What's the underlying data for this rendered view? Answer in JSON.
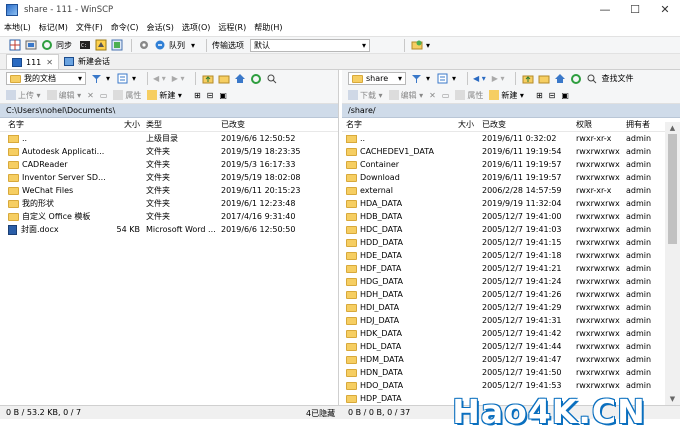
{
  "window": {
    "title": "share - 111 - WinSCP",
    "buttons": [
      "—",
      "☐",
      "✕"
    ]
  },
  "menu": [
    "本地(L)",
    "标记(M)",
    "文件(F)",
    "命令(C)",
    "会话(S)",
    "选项(O)",
    "远程(R)",
    "帮助(H)"
  ],
  "toolbar": {
    "sync_label": "同步",
    "queue_label": "队列",
    "transfer_label": "传输选项",
    "transfer_value": "默认"
  },
  "tabs": [
    {
      "label": "111"
    },
    {
      "label": "新建会话"
    }
  ],
  "left": {
    "location": "我的文档",
    "actions": {
      "upload": "上传",
      "edit": "编辑",
      "properties": "属性",
      "new": "新建"
    },
    "path": "C:\\Users\\nohel\\Documents\\",
    "headers": {
      "name": "名字",
      "size": "大小",
      "type": "类型",
      "changed": "已改变"
    },
    "rows": [
      {
        "name": "..",
        "size": "",
        "type": "上级目录",
        "changed": "2019/6/6  12:50:52",
        "kind": "up"
      },
      {
        "name": "Autodesk Applicati...",
        "size": "",
        "type": "文件夹",
        "changed": "2019/5/19  18:23:35",
        "kind": "folder"
      },
      {
        "name": "CADReader",
        "size": "",
        "type": "文件夹",
        "changed": "2019/5/3  16:17:33",
        "kind": "folder"
      },
      {
        "name": "Inventor Server SD...",
        "size": "",
        "type": "文件夹",
        "changed": "2019/5/19  18:02:08",
        "kind": "folder"
      },
      {
        "name": "WeChat Files",
        "size": "",
        "type": "文件夹",
        "changed": "2019/6/11  20:15:23",
        "kind": "folder"
      },
      {
        "name": "我的形状",
        "size": "",
        "type": "文件夹",
        "changed": "2019/6/1  12:23:48",
        "kind": "folder"
      },
      {
        "name": "自定义 Office 模板",
        "size": "",
        "type": "文件夹",
        "changed": "2017/4/16  9:31:40",
        "kind": "folder"
      },
      {
        "name": "封面.docx",
        "size": "54 KB",
        "type": "Microsoft Word ...",
        "changed": "2019/6/6  12:50:50",
        "kind": "doc"
      }
    ],
    "status_left": "0 B / 53.2 KB,  0 / 7",
    "status_right": "4已隐藏"
  },
  "right": {
    "location": "share",
    "find_label": "查找文件",
    "actions": {
      "download": "下载",
      "edit": "编辑",
      "properties": "属性",
      "new": "新建"
    },
    "path": "/share/",
    "headers": {
      "name": "名字",
      "size": "大小",
      "changed": "已改变",
      "rights": "权限",
      "owner": "拥有者"
    },
    "rows": [
      {
        "name": "..",
        "changed": "2019/6/11  0:32:02",
        "rights": "rwxr-xr-x",
        "owner": "admin",
        "kind": "up"
      },
      {
        "name": "CACHEDEV1_DATA",
        "changed": "2019/6/11  19:19:54",
        "rights": "rwxrwxrwx",
        "owner": "admin",
        "kind": "folder"
      },
      {
        "name": "Container",
        "changed": "2019/6/11  19:19:57",
        "rights": "rwxrwxrwx",
        "owner": "admin",
        "kind": "folder"
      },
      {
        "name": "Download",
        "changed": "2019/6/11  19:19:57",
        "rights": "rwxrwxrwx",
        "owner": "admin",
        "kind": "folder"
      },
      {
        "name": "external",
        "changed": "2006/2/28  14:57:59",
        "rights": "rwxr-xr-x",
        "owner": "admin",
        "kind": "folder"
      },
      {
        "name": "HDA_DATA",
        "changed": "2019/9/19  11:32:04",
        "rights": "rwxrwxrwx",
        "owner": "admin",
        "kind": "folder"
      },
      {
        "name": "HDB_DATA",
        "changed": "2005/12/7  19:41:00",
        "rights": "rwxrwxrwx",
        "owner": "admin",
        "kind": "folder"
      },
      {
        "name": "HDC_DATA",
        "changed": "2005/12/7  19:41:03",
        "rights": "rwxrwxrwx",
        "owner": "admin",
        "kind": "folder"
      },
      {
        "name": "HDD_DATA",
        "changed": "2005/12/7  19:41:15",
        "rights": "rwxrwxrwx",
        "owner": "admin",
        "kind": "folder"
      },
      {
        "name": "HDE_DATA",
        "changed": "2005/12/7  19:41:18",
        "rights": "rwxrwxrwx",
        "owner": "admin",
        "kind": "folder"
      },
      {
        "name": "HDF_DATA",
        "changed": "2005/12/7  19:41:21",
        "rights": "rwxrwxrwx",
        "owner": "admin",
        "kind": "folder"
      },
      {
        "name": "HDG_DATA",
        "changed": "2005/12/7  19:41:24",
        "rights": "rwxrwxrwx",
        "owner": "admin",
        "kind": "folder"
      },
      {
        "name": "HDH_DATA",
        "changed": "2005/12/7  19:41:26",
        "rights": "rwxrwxrwx",
        "owner": "admin",
        "kind": "folder"
      },
      {
        "name": "HDI_DATA",
        "changed": "2005/12/7  19:41:29",
        "rights": "rwxrwxrwx",
        "owner": "admin",
        "kind": "folder"
      },
      {
        "name": "HDJ_DATA",
        "changed": "2005/12/7  19:41:31",
        "rights": "rwxrwxrwx",
        "owner": "admin",
        "kind": "folder"
      },
      {
        "name": "HDK_DATA",
        "changed": "2005/12/7  19:41:42",
        "rights": "rwxrwxrwx",
        "owner": "admin",
        "kind": "folder"
      },
      {
        "name": "HDL_DATA",
        "changed": "2005/12/7  19:41:44",
        "rights": "rwxrwxrwx",
        "owner": "admin",
        "kind": "folder"
      },
      {
        "name": "HDM_DATA",
        "changed": "2005/12/7  19:41:47",
        "rights": "rwxrwxrwx",
        "owner": "admin",
        "kind": "folder"
      },
      {
        "name": "HDN_DATA",
        "changed": "2005/12/7  19:41:50",
        "rights": "rwxrwxrwx",
        "owner": "admin",
        "kind": "folder"
      },
      {
        "name": "HDO_DATA",
        "changed": "2005/12/7  19:41:53",
        "rights": "rwxrwxrwx",
        "owner": "admin",
        "kind": "folder"
      },
      {
        "name": "HDP_DATA",
        "changed": "",
        "rights": "",
        "owner": "",
        "kind": "folder"
      }
    ],
    "status_left": "0 B / 0 B,  0 / 37"
  },
  "watermark": "Hao4K.CN"
}
